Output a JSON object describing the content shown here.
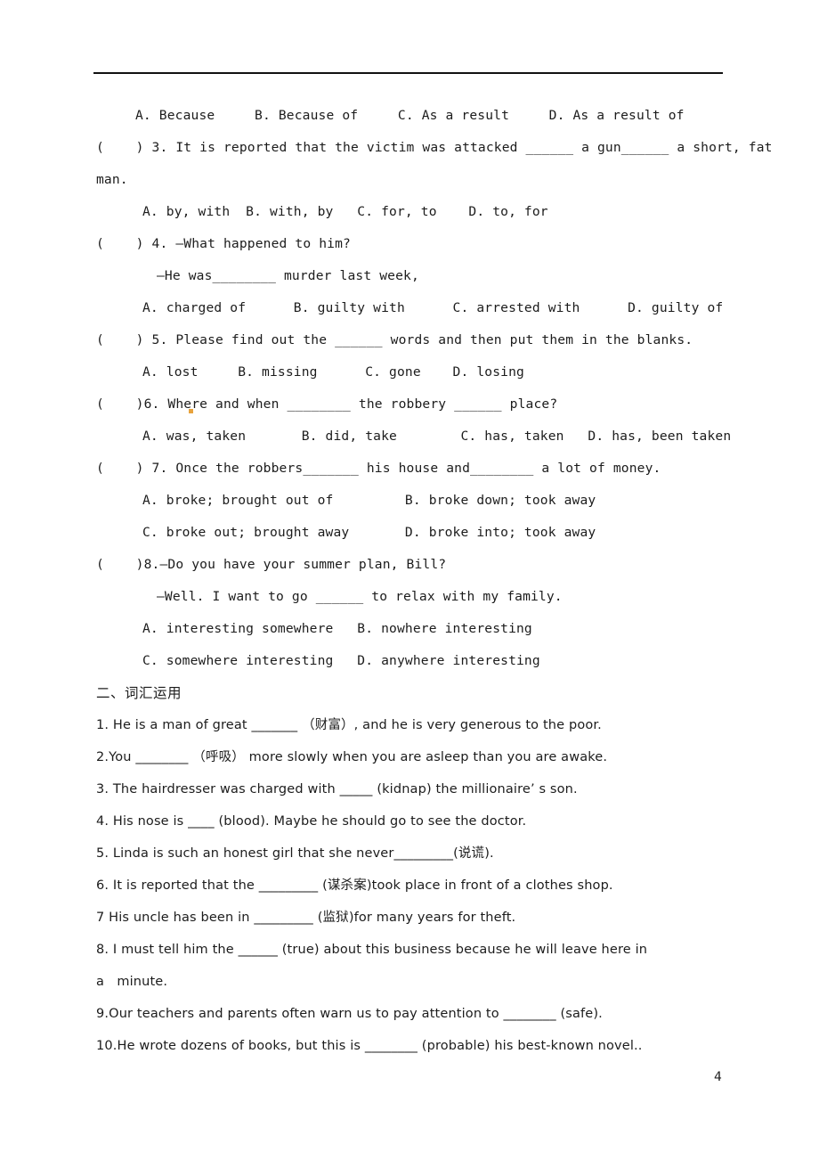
{
  "document": {
    "page_number": "4",
    "header_rule": true
  },
  "lines": [
    {
      "id": "q2-options",
      "indent": "ind1",
      "text": "A. Because     B. Because of     C. As a result     D. As a result of"
    },
    {
      "id": "q3-stem",
      "indent": "ind0",
      "text": "(    ) 3. It is reported that the victim was attacked ______ a gun______ a short, fat"
    },
    {
      "id": "q3-stem-cont",
      "indent": "left0",
      "text": "man."
    },
    {
      "id": "q3-options",
      "indent": "ind2",
      "text": "A. by, with  B. with, by   C. for, to    D. to, for"
    },
    {
      "id": "q4-stem",
      "indent": "ind0",
      "text": "(    ) 4. —What happened to him?"
    },
    {
      "id": "q4-stem-cont",
      "indent": "ind3",
      "text": "—He was________ murder last week,"
    },
    {
      "id": "q4-options",
      "indent": "ind2",
      "text": "A. charged of      B. guilty with      C. arrested with      D. guilty of"
    },
    {
      "id": "q5-stem",
      "indent": "ind0",
      "text": "(    ) 5. Please find out the ______ words and then put them in the blanks."
    },
    {
      "id": "q5-options",
      "indent": "ind2",
      "text": "A. lost     B. missing      C. gone    D. losing"
    },
    {
      "id": "q6-stem",
      "indent": "ind0",
      "text": "(    )6. Where and when ________ the robbery ______ place?"
    },
    {
      "id": "q6-options",
      "indent": "ind2",
      "text": "A. was, taken       B. did, take        C. has, taken   D. has, been taken"
    },
    {
      "id": "q7-stem",
      "indent": "ind0",
      "text": "(    ) 7. Once the robbers_______ his house and________ a lot of money."
    },
    {
      "id": "q7-options-ab",
      "indent": "ind2",
      "text": "A. broke; brought out of         B. broke down; took away"
    },
    {
      "id": "q7-options-cd",
      "indent": "ind2",
      "text": "C. broke out; brought away       D. broke into; took away"
    },
    {
      "id": "q8-stem",
      "indent": "ind0",
      "text": "(    )8.—Do you have your summer plan, Bill?"
    },
    {
      "id": "q8-stem-cont",
      "indent": "ind3",
      "text": "—Well. I want to go ______ to relax with my family."
    },
    {
      "id": "q8-options-ab",
      "indent": "ind2",
      "text": "A. interesting somewhere   B. nowhere interesting"
    },
    {
      "id": "q8-options-cd",
      "indent": "ind2",
      "text": "C. somewhere interesting   D. anywhere interesting"
    },
    {
      "id": "section2-heading",
      "indent": "left0",
      "text": "二、词汇运用",
      "style": "zh-head"
    },
    {
      "id": "vocab-1",
      "indent": "left0",
      "text": "1. He is a man of great _______ （财富）, and he is very generous to the poor."
    },
    {
      "id": "vocab-2",
      "indent": "left0",
      "text": "2.You ________ （呼吸） more slowly when you are asleep than you are awake."
    },
    {
      "id": "vocab-3",
      "indent": "left0",
      "text": "3. The hairdresser was charged with _____ (kidnap) the millionaire’ s son."
    },
    {
      "id": "vocab-4",
      "indent": "left0",
      "text": "4. His nose is ____ (blood). Maybe he should go to see the doctor."
    },
    {
      "id": "vocab-5",
      "indent": "left0",
      "text": "5. Linda is such an honest girl that she never_________(说谎)."
    },
    {
      "id": "vocab-6",
      "indent": "left0",
      "text": "6. It is reported that the _________ (谋杀案)took place in front of a clothes shop."
    },
    {
      "id": "vocab-7",
      "indent": "left0",
      "text": "7 His uncle has been in _________ (监狱)for many years for theft."
    },
    {
      "id": "vocab-8",
      "indent": "left0",
      "text": "8. I must tell him the ______ (true) about this business because he will leave here in"
    },
    {
      "id": "vocab-8-cont",
      "indent": "left0",
      "text": "a   minute."
    },
    {
      "id": "vocab-9",
      "indent": "left0",
      "text": "9.Our teachers and parents often warn us to pay attention to ________ (safe)."
    },
    {
      "id": "vocab-10",
      "indent": "left0",
      "text": "10.He wrote dozens of books, but this is ________ (probable) his best-known novel.."
    }
  ],
  "annotations": {
    "spellcheck_mark_color": "#e8a33d",
    "spellcheck_mark_word": "Where"
  }
}
